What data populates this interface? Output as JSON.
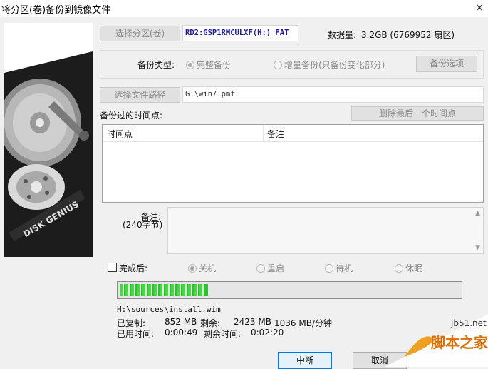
{
  "window": {
    "title": "将分区(卷)备份到镜像文件",
    "close_glyph": "✕"
  },
  "source": {
    "select_button": "选择分区(卷)",
    "partition": "RD2:GSP1RMCULXF(H:) FAT",
    "data_label": "数据量:",
    "data_value": "3.2GB (6769952 扇区)"
  },
  "backup_type": {
    "label": "备份类型:",
    "options": [
      {
        "label": "完整备份",
        "checked": true
      },
      {
        "label": "增量备份(只备份变化部分)",
        "checked": false
      }
    ],
    "options_button": "备份选项"
  },
  "file": {
    "select_button": "选择文件路径",
    "path": "G:\\win7.pmf"
  },
  "timepoints": {
    "label": "备份过的时间点:",
    "delete_button": "删除最后一个时间点",
    "columns": [
      "时间点",
      "备注"
    ],
    "rows": []
  },
  "note": {
    "label": "备注:",
    "limit": "(240字节)",
    "value": ""
  },
  "after_complete": {
    "label": "完成后:",
    "checked": false,
    "options": [
      {
        "label": "关机",
        "checked": true
      },
      {
        "label": "重启",
        "checked": false
      },
      {
        "label": "待机",
        "checked": false
      },
      {
        "label": "休眠",
        "checked": false
      }
    ]
  },
  "progress": {
    "fraction": 0.26,
    "current_file": "H:\\sources\\install.wim",
    "copied_label": "已复制:",
    "copied": "852 MB",
    "remaining_label": "剩余:",
    "remaining": "2423 MB",
    "speed": "1036 MB/分钟",
    "elapsed_label": "已用时间:",
    "elapsed": "0:00:49",
    "time_left_label": "剩余时间:",
    "time_left": "0:02:20"
  },
  "buttons": {
    "abort": "中断",
    "cancel": "取消"
  },
  "branding": {
    "hdd_label": "DISK GENIUS",
    "site": "jb51.net",
    "site_name": "脚本之家"
  },
  "colors": {
    "progress_fill": "#2ec22e",
    "default_button_border": "#0078d7",
    "partition_text": "#1a1aa8"
  }
}
